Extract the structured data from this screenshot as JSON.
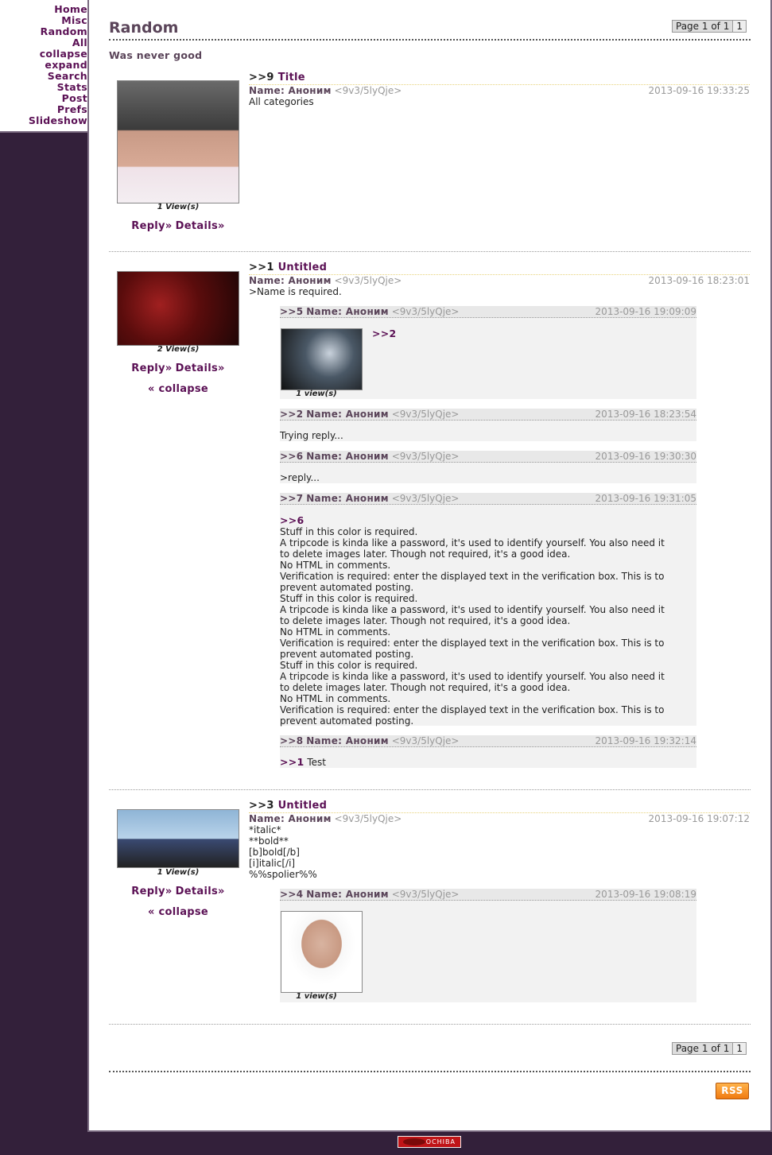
{
  "menu": [
    "Home",
    "Misc",
    "Random",
    "All",
    "collapse",
    "expand",
    "Search",
    "Stats",
    "Post",
    "Prefs",
    "Slideshow"
  ],
  "board": {
    "title": "Random",
    "subtitle": "Was never good"
  },
  "pager": {
    "label": "Page 1 of 1",
    "page": "1"
  },
  "threads": [
    {
      "num": ">>9",
      "title": "Title",
      "name": "Name: Аноним",
      "trip": "<9v3/5lyQje>",
      "date": "2013-09-16 19:33:25",
      "body": [
        "All categories"
      ],
      "views": "1 View(s)",
      "reply": "Reply»",
      "details": "Details»"
    },
    {
      "num": ">>1",
      "title": "Untitled",
      "name": "Name: Аноним",
      "trip": "<9v3/5lyQje>",
      "date": "2013-09-16 18:23:01",
      "body": [
        ">Name is required."
      ],
      "views": "2 View(s)",
      "reply": "Reply»",
      "details": "Details»",
      "collapse": "« collapse"
    },
    {
      "num": ">>3",
      "title": "Untitled",
      "name": "Name: Аноним",
      "trip": "<9v3/5lyQje>",
      "date": "2013-09-16 19:07:12",
      "body": [
        "*italic*",
        "**bold**",
        "[b]bold[/b]",
        "[i]italic[/i]",
        "%%spolier%%"
      ],
      "views": "1 View(s)",
      "reply": "Reply»",
      "details": "Details»",
      "collapse": "« collapse"
    }
  ],
  "replies": [
    {
      "num": ">>5",
      "name": "Name: Аноним",
      "trip": "<9v3/5lyQje>",
      "date": "2013-09-16 19:09:09",
      "quote": ">>2",
      "views": "1 view(s)"
    },
    {
      "num": ">>2",
      "name": "Name: Аноним",
      "trip": "<9v3/5lyQje>",
      "date": "2013-09-16 18:23:54",
      "text": "Trying reply..."
    },
    {
      "num": ">>6",
      "name": "Name: Аноним",
      "trip": "<9v3/5lyQje>",
      "date": "2013-09-16 19:30:30",
      "text": ">reply..."
    },
    {
      "num": ">>7",
      "name": "Name: Аноним",
      "trip": "<9v3/5lyQje>",
      "date": "2013-09-16 19:31:05",
      "quote": ">>6",
      "lines": [
        "Stuff in this color is required.",
        "A tripcode is kinda like a password, it's used to identify yourself. You also need it",
        "to delete images later. Though not required, it's a good idea.",
        "No HTML in comments.",
        "Verification is required: enter the displayed text in the verification box. This is to",
        "prevent automated posting.",
        "Stuff in this color is required.",
        "A tripcode is kinda like a password, it's used to identify yourself. You also need it",
        "to delete images later. Though not required, it's a good idea.",
        "No HTML in comments.",
        "Verification is required: enter the displayed text in the verification box. This is to",
        "prevent automated posting.",
        "Stuff in this color is required.",
        "A tripcode is kinda like a password, it's used to identify yourself. You also need it",
        "to delete images later. Though not required, it's a good idea.",
        "No HTML in comments.",
        "Verification is required: enter the displayed text in the verification box. This is to",
        "prevent automated posting."
      ]
    },
    {
      "num": ">>8",
      "name": "Name: Аноним",
      "trip": "<9v3/5lyQje>",
      "date": "2013-09-16 19:32:14",
      "quote": ">>1",
      "text": " Test"
    },
    {
      "num": ">>4",
      "name": "Name: Аноним",
      "trip": "<9v3/5lyQje>",
      "date": "2013-09-16 19:08:19",
      "views": "1 view(s)"
    }
  ],
  "rss": "RSS",
  "footer": "OCHIBA"
}
